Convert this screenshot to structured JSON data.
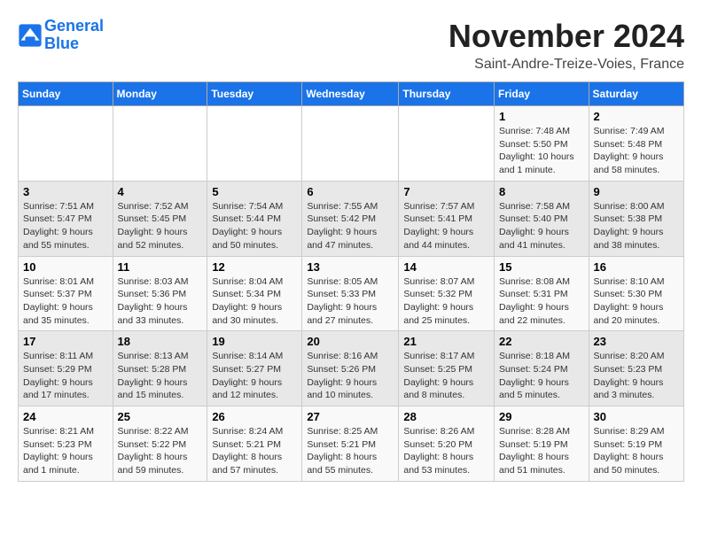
{
  "header": {
    "logo_line1": "General",
    "logo_line2": "Blue",
    "month": "November 2024",
    "location": "Saint-Andre-Treize-Voies, France"
  },
  "weekdays": [
    "Sunday",
    "Monday",
    "Tuesday",
    "Wednesday",
    "Thursday",
    "Friday",
    "Saturday"
  ],
  "weeks": [
    [
      {
        "day": "",
        "detail": ""
      },
      {
        "day": "",
        "detail": ""
      },
      {
        "day": "",
        "detail": ""
      },
      {
        "day": "",
        "detail": ""
      },
      {
        "day": "",
        "detail": ""
      },
      {
        "day": "1",
        "detail": "Sunrise: 7:48 AM\nSunset: 5:50 PM\nDaylight: 10 hours and 1 minute."
      },
      {
        "day": "2",
        "detail": "Sunrise: 7:49 AM\nSunset: 5:48 PM\nDaylight: 9 hours and 58 minutes."
      }
    ],
    [
      {
        "day": "3",
        "detail": "Sunrise: 7:51 AM\nSunset: 5:47 PM\nDaylight: 9 hours and 55 minutes."
      },
      {
        "day": "4",
        "detail": "Sunrise: 7:52 AM\nSunset: 5:45 PM\nDaylight: 9 hours and 52 minutes."
      },
      {
        "day": "5",
        "detail": "Sunrise: 7:54 AM\nSunset: 5:44 PM\nDaylight: 9 hours and 50 minutes."
      },
      {
        "day": "6",
        "detail": "Sunrise: 7:55 AM\nSunset: 5:42 PM\nDaylight: 9 hours and 47 minutes."
      },
      {
        "day": "7",
        "detail": "Sunrise: 7:57 AM\nSunset: 5:41 PM\nDaylight: 9 hours and 44 minutes."
      },
      {
        "day": "8",
        "detail": "Sunrise: 7:58 AM\nSunset: 5:40 PM\nDaylight: 9 hours and 41 minutes."
      },
      {
        "day": "9",
        "detail": "Sunrise: 8:00 AM\nSunset: 5:38 PM\nDaylight: 9 hours and 38 minutes."
      }
    ],
    [
      {
        "day": "10",
        "detail": "Sunrise: 8:01 AM\nSunset: 5:37 PM\nDaylight: 9 hours and 35 minutes."
      },
      {
        "day": "11",
        "detail": "Sunrise: 8:03 AM\nSunset: 5:36 PM\nDaylight: 9 hours and 33 minutes."
      },
      {
        "day": "12",
        "detail": "Sunrise: 8:04 AM\nSunset: 5:34 PM\nDaylight: 9 hours and 30 minutes."
      },
      {
        "day": "13",
        "detail": "Sunrise: 8:05 AM\nSunset: 5:33 PM\nDaylight: 9 hours and 27 minutes."
      },
      {
        "day": "14",
        "detail": "Sunrise: 8:07 AM\nSunset: 5:32 PM\nDaylight: 9 hours and 25 minutes."
      },
      {
        "day": "15",
        "detail": "Sunrise: 8:08 AM\nSunset: 5:31 PM\nDaylight: 9 hours and 22 minutes."
      },
      {
        "day": "16",
        "detail": "Sunrise: 8:10 AM\nSunset: 5:30 PM\nDaylight: 9 hours and 20 minutes."
      }
    ],
    [
      {
        "day": "17",
        "detail": "Sunrise: 8:11 AM\nSunset: 5:29 PM\nDaylight: 9 hours and 17 minutes."
      },
      {
        "day": "18",
        "detail": "Sunrise: 8:13 AM\nSunset: 5:28 PM\nDaylight: 9 hours and 15 minutes."
      },
      {
        "day": "19",
        "detail": "Sunrise: 8:14 AM\nSunset: 5:27 PM\nDaylight: 9 hours and 12 minutes."
      },
      {
        "day": "20",
        "detail": "Sunrise: 8:16 AM\nSunset: 5:26 PM\nDaylight: 9 hours and 10 minutes."
      },
      {
        "day": "21",
        "detail": "Sunrise: 8:17 AM\nSunset: 5:25 PM\nDaylight: 9 hours and 8 minutes."
      },
      {
        "day": "22",
        "detail": "Sunrise: 8:18 AM\nSunset: 5:24 PM\nDaylight: 9 hours and 5 minutes."
      },
      {
        "day": "23",
        "detail": "Sunrise: 8:20 AM\nSunset: 5:23 PM\nDaylight: 9 hours and 3 minutes."
      }
    ],
    [
      {
        "day": "24",
        "detail": "Sunrise: 8:21 AM\nSunset: 5:23 PM\nDaylight: 9 hours and 1 minute."
      },
      {
        "day": "25",
        "detail": "Sunrise: 8:22 AM\nSunset: 5:22 PM\nDaylight: 8 hours and 59 minutes."
      },
      {
        "day": "26",
        "detail": "Sunrise: 8:24 AM\nSunset: 5:21 PM\nDaylight: 8 hours and 57 minutes."
      },
      {
        "day": "27",
        "detail": "Sunrise: 8:25 AM\nSunset: 5:21 PM\nDaylight: 8 hours and 55 minutes."
      },
      {
        "day": "28",
        "detail": "Sunrise: 8:26 AM\nSunset: 5:20 PM\nDaylight: 8 hours and 53 minutes."
      },
      {
        "day": "29",
        "detail": "Sunrise: 8:28 AM\nSunset: 5:19 PM\nDaylight: 8 hours and 51 minutes."
      },
      {
        "day": "30",
        "detail": "Sunrise: 8:29 AM\nSunset: 5:19 PM\nDaylight: 8 hours and 50 minutes."
      }
    ]
  ]
}
